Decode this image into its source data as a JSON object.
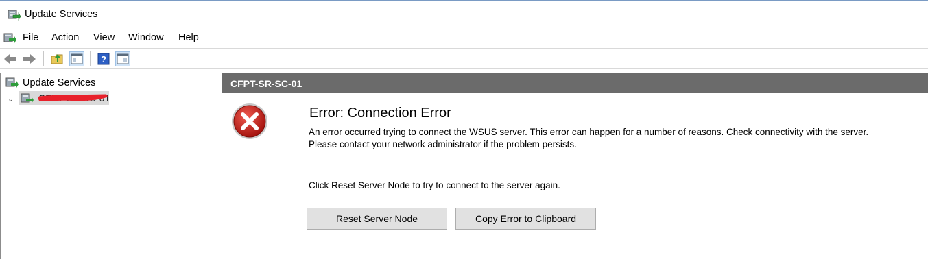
{
  "window": {
    "title": "Update Services"
  },
  "menu": {
    "items": [
      "File",
      "Action",
      "View",
      "Window",
      "Help"
    ]
  },
  "toolbar": {
    "buttons": [
      "back-arrow-icon",
      "forward-arrow-icon",
      "up-folder-icon",
      "show-hide-console-tree-icon",
      "help-icon",
      "show-hide-action-pane-icon"
    ]
  },
  "tree": {
    "root_label": "Update Services",
    "server_label": "CFPT-SR-SC-01"
  },
  "panel": {
    "header": "CFPT-SR-SC-01",
    "error_title": "Error: Connection Error",
    "error_line1": "An error occurred trying to connect the WSUS server. This error can happen for a number of reasons. Check connectivity with the server.",
    "error_line2": "Please contact your network administrator if the problem persists.",
    "hint": "Click Reset Server Node to try to connect to the server again.",
    "reset_button": "Reset Server Node",
    "copy_button": "Copy Error to Clipboard"
  },
  "colors": {
    "header_bg": "#6b6b6b",
    "error_red": "#c8201f",
    "redaction": "#e8202a"
  }
}
